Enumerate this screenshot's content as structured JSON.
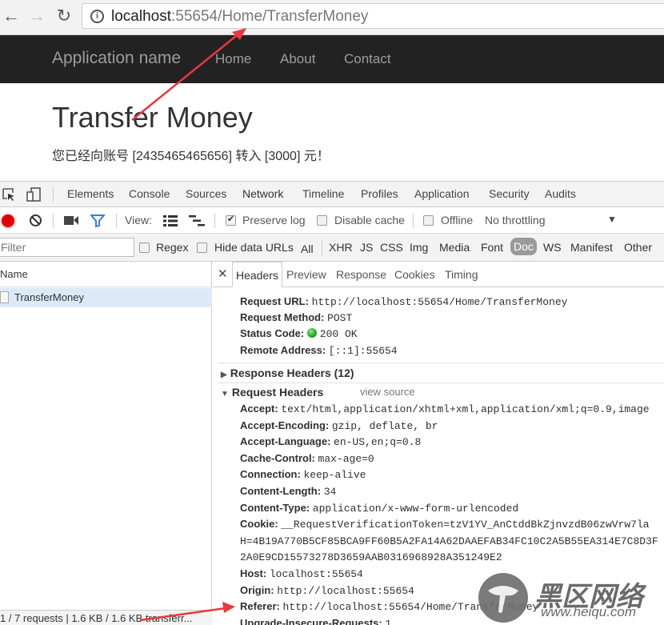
{
  "browser": {
    "back_icon": "arrow-left",
    "forward_icon": "arrow-right",
    "reload_icon": "reload",
    "url_host": "localhost",
    "url_rest": ":55654/Home/TransferMoney"
  },
  "site": {
    "brand": "Application name",
    "nav": [
      "Home",
      "About",
      "Contact"
    ],
    "title": "Transfer Money",
    "message": "您已经向账号 [2435465465656] 转入 [3000] 元！"
  },
  "devtools": {
    "tabs": [
      "Elements",
      "Console",
      "Sources",
      "Network",
      "Timeline",
      "Profiles",
      "Application",
      "Security",
      "Audits"
    ],
    "active_tab": "Network",
    "toolbar": {
      "view_label": "View:",
      "preserve_log": "Preserve log",
      "preserve_log_checked": true,
      "disable_cache": "Disable cache",
      "offline": "Offline",
      "throttling": "No throttling"
    },
    "filter": {
      "placeholder": "Filter",
      "regex": "Regex",
      "hide_data_urls": "Hide data URLs",
      "types": [
        "All",
        "XHR",
        "JS",
        "CSS",
        "Img",
        "Media",
        "Font",
        "Doc",
        "WS",
        "Manifest",
        "Other"
      ],
      "active_type": "Doc"
    },
    "request_list": {
      "column_name": "Name",
      "rows": [
        "TransferMoney"
      ],
      "status": "1 / 7 requests  |  1.6 KB / 1.6 KB transferr..."
    },
    "details": {
      "tabs": [
        "Headers",
        "Preview",
        "Response",
        "Cookies",
        "Timing"
      ],
      "active_tab": "Headers",
      "general": [
        {
          "key": "Request URL:",
          "value": "http://localhost:55654/Home/TransferMoney"
        },
        {
          "key": "Request Method:",
          "value": "POST"
        },
        {
          "key": "Status Code:",
          "value": "200 OK"
        },
        {
          "key": "Remote Address:",
          "value": "[::1]:55654"
        }
      ],
      "response_headers_label": "Response Headers (12)",
      "request_headers_label": "Request Headers",
      "view_source": "view source",
      "request_headers": [
        {
          "key": "Accept:",
          "value": "text/html,application/xhtml+xml,application/xml;q=0.9,image"
        },
        {
          "key": "Accept-Encoding:",
          "value": "gzip, deflate, br"
        },
        {
          "key": "Accept-Language:",
          "value": "en-US,en;q=0.8"
        },
        {
          "key": "Cache-Control:",
          "value": "max-age=0"
        },
        {
          "key": "Connection:",
          "value": "keep-alive"
        },
        {
          "key": "Content-Length:",
          "value": "34"
        },
        {
          "key": "Content-Type:",
          "value": "application/x-www-form-urlencoded"
        },
        {
          "key": "Cookie:",
          "value": "__RequestVerificationToken=tzV1YV_AnCtddBkZjnvzdB06zwVrw7la"
        },
        {
          "key": "",
          "value": "H=4B19A770B5CF85BCA9FF60B5A2FA14A62DAAEFAB34FC10C2A5B55EA314E7C8D3F"
        },
        {
          "key": "",
          "value": "2A0E9CD15573278D3659AAB0316968928A351249E2"
        },
        {
          "key": "Host:",
          "value": "localhost:55654"
        },
        {
          "key": "Origin:",
          "value": "http://localhost:55654"
        },
        {
          "key": "Referer:",
          "value": "http://localhost:55654/Home/TransferMoney"
        },
        {
          "key": "Upgrade-Insecure-Requests:",
          "value": "1"
        }
      ]
    }
  },
  "watermark": {
    "text": "黑区网络",
    "url": "www.heiqu.com"
  },
  "colors": {
    "navbar_bg": "#222222",
    "record_red": "#e00000",
    "active_tab_underline": "#3e82f7",
    "selected_row": "#dce9f8",
    "annotation_arrow": "#e8383d",
    "status_ok": "#1ea51e"
  }
}
